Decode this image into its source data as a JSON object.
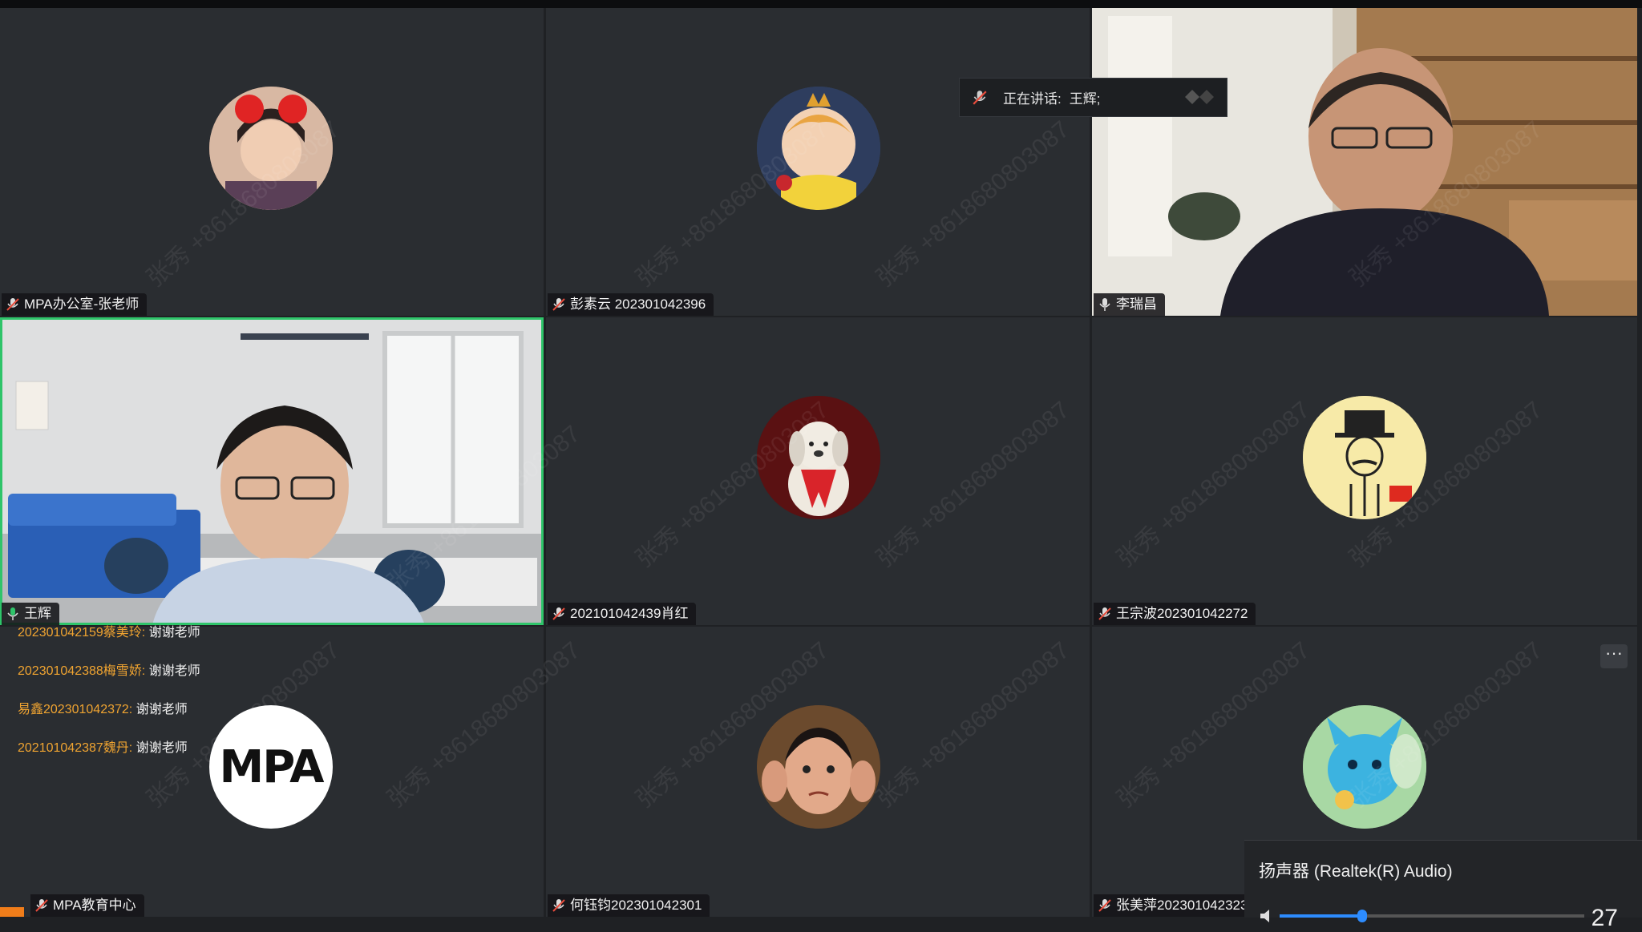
{
  "speaking": {
    "label": "正在讲话:",
    "name": "王辉;"
  },
  "tiles": [
    {
      "name": "MPA办公室-张老师"
    },
    {
      "name": "彭素云 202301042396"
    },
    {
      "name": "李瑞昌"
    },
    {
      "name": "王辉"
    },
    {
      "name": "202101042439肖红"
    },
    {
      "name": "王宗波202301042272"
    },
    {
      "name": "MPA教育中心"
    },
    {
      "name": "何钰钧202301042301"
    },
    {
      "name": "张美萍202301042323"
    }
  ],
  "chat": [
    {
      "sender": "202301042159蔡美玲:",
      "message": "谢谢老师"
    },
    {
      "sender": "202301042388梅雪娇:",
      "message": "谢谢老师"
    },
    {
      "sender": "易鑫202301042372:",
      "message": "谢谢老师"
    },
    {
      "sender": "202101042387魏丹:",
      "message": "谢谢老师"
    }
  ],
  "mpa_logo": "MPA",
  "watermark": "张秀 +8618680803087",
  "more_button": "···",
  "speaker_popup": {
    "title": "扬声器 (Realtek(R) Audio)",
    "volume": "27",
    "level": 0.27
  },
  "colors": {
    "active_border": "#2fc46a",
    "sender": "#f0a431",
    "accent": "#2d8cff"
  }
}
